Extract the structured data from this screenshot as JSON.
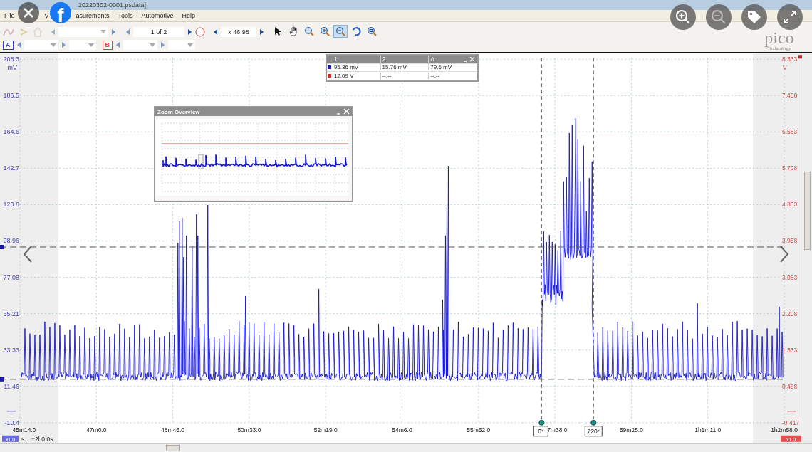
{
  "window": {
    "title": "20220302-0001.psdata]"
  },
  "menu": [
    "File",
    "V",
    "asurements",
    "Tools",
    "Automotive",
    "Help"
  ],
  "toolbar": {
    "page": "1 of 2",
    "zoom": "x 46.98",
    "tools": [
      {
        "kind": "pointer",
        "selected": false
      },
      {
        "kind": "hand",
        "selected": false
      },
      {
        "kind": "zoom",
        "selected": false
      },
      {
        "kind": "zoom-in",
        "selected": false
      },
      {
        "kind": "zoom-out",
        "selected": true
      },
      {
        "kind": "undo",
        "selected": false
      },
      {
        "kind": "zoom-fit",
        "selected": false
      }
    ]
  },
  "channels": [
    {
      "label": "A",
      "color": "#3a3ac8"
    },
    {
      "label": "B",
      "color": "#d04444"
    }
  ],
  "logo": {
    "name": "pico",
    "tagline": "Technology"
  },
  "overlay": {
    "brand_letter": "f"
  },
  "scope": {
    "left_unit": "mV",
    "left_ticks": [
      "208.3",
      "186.5",
      "164.6",
      "142.7",
      "120.8",
      "98.96",
      "77.08",
      "55.21",
      "33.33",
      "11.46",
      "-10.4"
    ],
    "right_unit": "V",
    "right_ticks": [
      "8.333",
      "7.458",
      "6.583",
      "5.708",
      "4.833",
      "3.958",
      "3.083",
      "2.208",
      "1.333",
      "0.458",
      "-0.417"
    ],
    "x_ticks": [
      "45m14.0",
      "47m0.0",
      "48m46.0",
      "50m33.0",
      "52m19.0",
      "54m6.0",
      "55m52.0",
      "7m38.0",
      "59m25.0",
      "1h1m11.0",
      "1h2m58.0"
    ],
    "cursor_labels": [
      "0°",
      "720°"
    ],
    "scale_left": "x1.0",
    "time_unit": "s",
    "offset": "+2h0.0s",
    "scale_right": "x1.0"
  },
  "measurements": {
    "columns": [
      "1",
      "2",
      "Δ"
    ],
    "rows": [
      {
        "color": "#1c1cb0",
        "cells": [
          "95.36 mV",
          "15.76 mV",
          "79.6 mV"
        ]
      },
      {
        "color": "#c83030",
        "cells": [
          "12.09 V",
          "--.--",
          "--.--"
        ]
      }
    ]
  },
  "zoom_overview": {
    "title": "Zoom Overview"
  }
}
